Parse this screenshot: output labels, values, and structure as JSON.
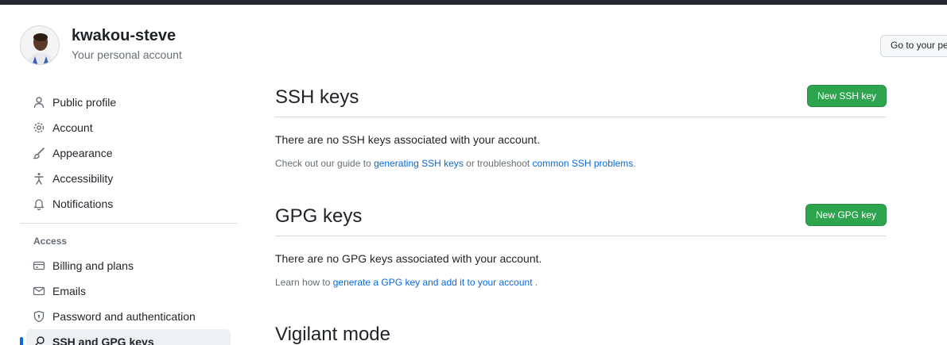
{
  "account": {
    "username": "kwakou-steve",
    "subtitle": "Your personal account",
    "goto_button": "Go to your personal profile"
  },
  "sidebar": {
    "items": [
      {
        "label": "Public profile",
        "icon": "person-icon"
      },
      {
        "label": "Account",
        "icon": "gear-icon"
      },
      {
        "label": "Appearance",
        "icon": "paintbrush-icon"
      },
      {
        "label": "Accessibility",
        "icon": "accessibility-icon"
      },
      {
        "label": "Notifications",
        "icon": "bell-icon"
      }
    ],
    "access_heading": "Access",
    "access_items": [
      {
        "label": "Billing and plans",
        "icon": "credit-card-icon"
      },
      {
        "label": "Emails",
        "icon": "mail-icon"
      },
      {
        "label": "Password and authentication",
        "icon": "shield-lock-icon"
      },
      {
        "label": "SSH and GPG keys",
        "icon": "key-icon",
        "active": true
      }
    ]
  },
  "ssh": {
    "title": "SSH keys",
    "button": "New SSH key",
    "empty": "There are no SSH keys associated with your account.",
    "help_prefix": "Check out our guide to ",
    "help_link1": "generating SSH keys",
    "help_middle": " or troubleshoot ",
    "help_link2": "common SSH problems",
    "help_suffix": "."
  },
  "gpg": {
    "title": "GPG keys",
    "button": "New GPG key",
    "empty": "There are no GPG keys associated with your account.",
    "help_prefix": "Learn how to ",
    "help_link": "generate a GPG key and add it to your account",
    "help_suffix": " ."
  },
  "vigilant": {
    "title": "Vigilant mode"
  },
  "colors": {
    "accent": "#0969da",
    "primary_button": "#2da44e",
    "topbar": "#24292f"
  }
}
